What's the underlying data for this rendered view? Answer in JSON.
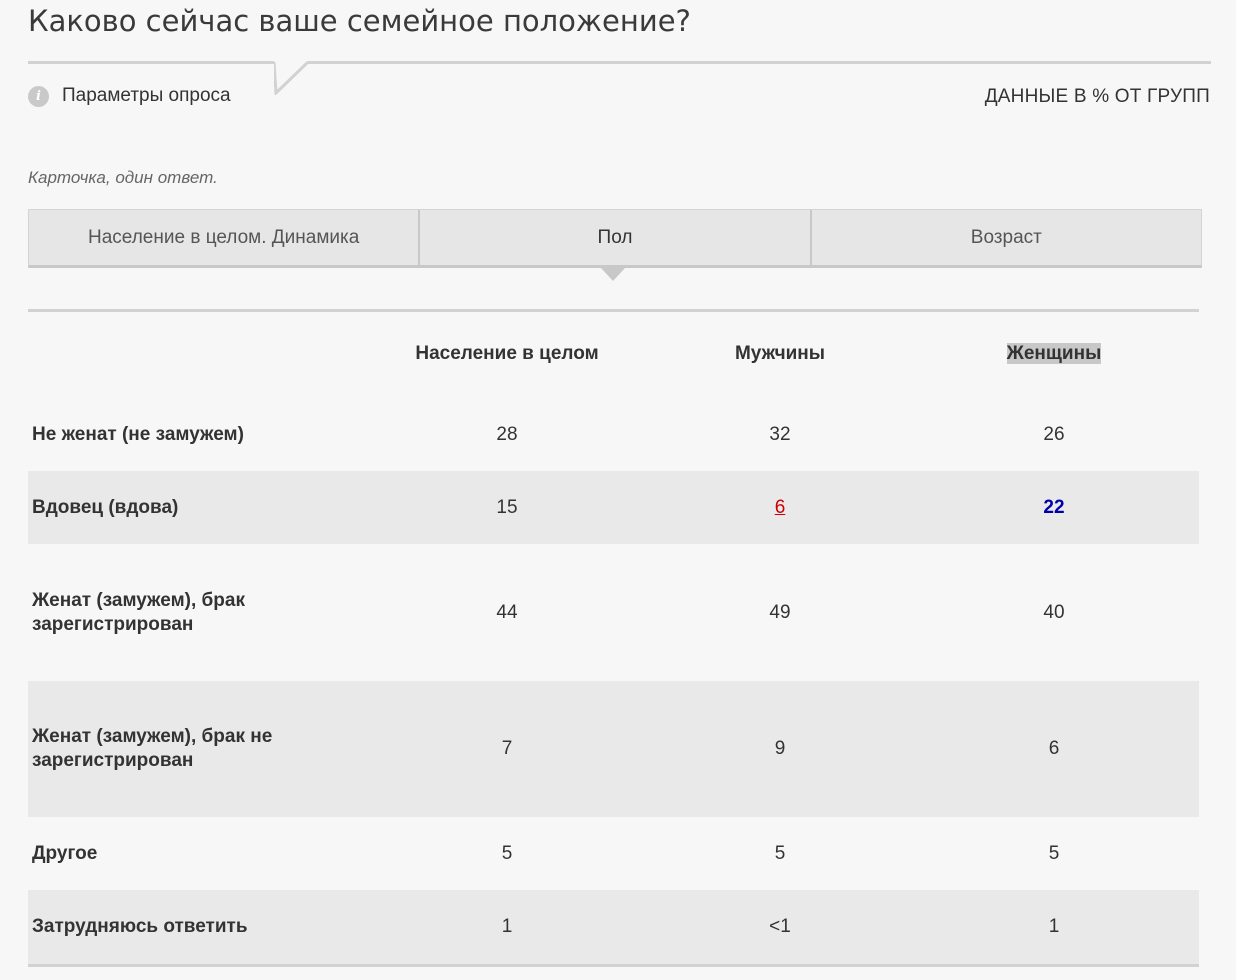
{
  "title": "Каково сейчас ваше семейное положение?",
  "survey_params_label": "Параметры опроса",
  "data_mode_label": "ДАННЫЕ В % ОТ ГРУПП",
  "subtitle": "Карточка, один ответ.",
  "tabs": [
    {
      "label": "Население в целом. Динамика",
      "active": false
    },
    {
      "label": "Пол",
      "active": true
    },
    {
      "label": "Возраст",
      "active": false
    }
  ],
  "columns": [
    "Население в целом",
    "Мужчины",
    "Женщины"
  ],
  "rows": [
    {
      "label": "Не женат (не замужем)",
      "values": [
        "28",
        "32",
        "26"
      ]
    },
    {
      "label": "Вдовец (вдова)",
      "values": [
        "15",
        "6",
        "22"
      ]
    },
    {
      "label": "Женат (замужем), брак зарегистрирован",
      "values": [
        "44",
        "49",
        "40"
      ]
    },
    {
      "label": "Женат (замужем), брак не зарегистрирован",
      "values": [
        "7",
        "9",
        "6"
      ]
    },
    {
      "label": "Другое",
      "values": [
        "5",
        "5",
        "5"
      ]
    },
    {
      "label": "Затрудняюсь ответить",
      "values": [
        "1",
        "<1",
        "1"
      ]
    }
  ],
  "colors": {
    "low": "#cc0000",
    "high": "#0000aa",
    "row_shade": "#e9e9e9"
  }
}
